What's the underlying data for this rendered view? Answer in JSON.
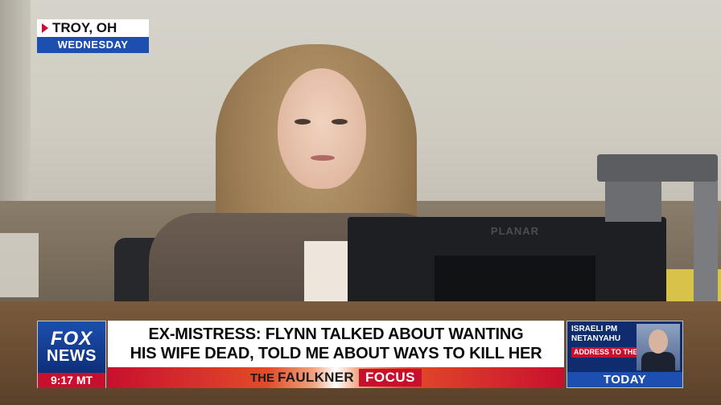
{
  "location_bug": {
    "city": "TROY, OH",
    "day": "WEDNESDAY"
  },
  "network": {
    "brand_line1": "FOX",
    "brand_line2": "NEWS",
    "time": "9:17 MT"
  },
  "headline": {
    "line1": "EX-MISTRESS: FLYNN TALKED ABOUT WANTING",
    "line2": "HIS WIFE DEAD, TOLD ME ABOUT WAYS TO KILL HER"
  },
  "show": {
    "prefix": "THE",
    "name": "FAULKNER",
    "highlight": "FOCUS"
  },
  "promo": {
    "line1": "ISRAELI PM",
    "line2": "NETANYAHU",
    "line3": "ADDRESS TO THE U.N.",
    "when": "TODAY"
  },
  "scene": {
    "monitor_brand": "PLANAR"
  },
  "colors": {
    "fox_blue": "#1d4fb0",
    "fox_red": "#c8102e",
    "navy": "#0f2c6e"
  }
}
